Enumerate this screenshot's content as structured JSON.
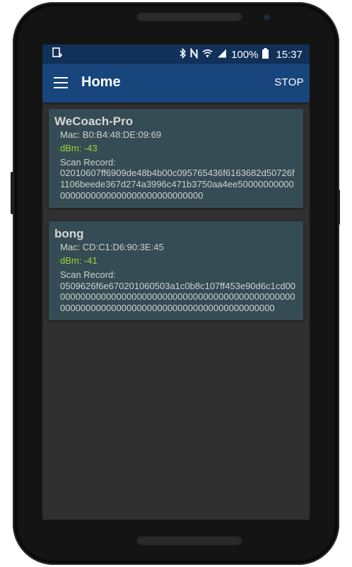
{
  "statusbar": {
    "icons": [
      "cast-icon",
      "bluetooth-icon",
      "nfc-icon",
      "wifi-icon",
      "signal-icon",
      "battery-icon"
    ],
    "battery": "100%",
    "time": "15:37"
  },
  "appbar": {
    "title": "Home",
    "action": "STOP"
  },
  "devices": [
    {
      "name": "WeCoach-Pro",
      "mac": "Mac: B0:B4:48:DE:09:69",
      "rssi": "dBm:  -43",
      "record_label": "Scan Record:",
      "record": "02010607ff6909de48b4b00c095765436f6163682d50726f1106beede367d274a3996c471b3750aa4ee500000000000000000000000000000000000000"
    },
    {
      "name": "bong",
      "mac": "Mac: CD:C1:D6:90:3E:45",
      "rssi": "dBm:  -41",
      "record_label": "Scan Record:",
      "record": "0509626f6e670201060503a1c0b8c107ff453e90d6c1cd000000000000000000000000000000000000000000000000000000000000000000000000000000000000000000"
    }
  ],
  "colors": {
    "statusbar": "#11305a",
    "appbar": "#17457c",
    "card": "#354c54",
    "rssi": "#9fd23a",
    "background": "#303030"
  }
}
